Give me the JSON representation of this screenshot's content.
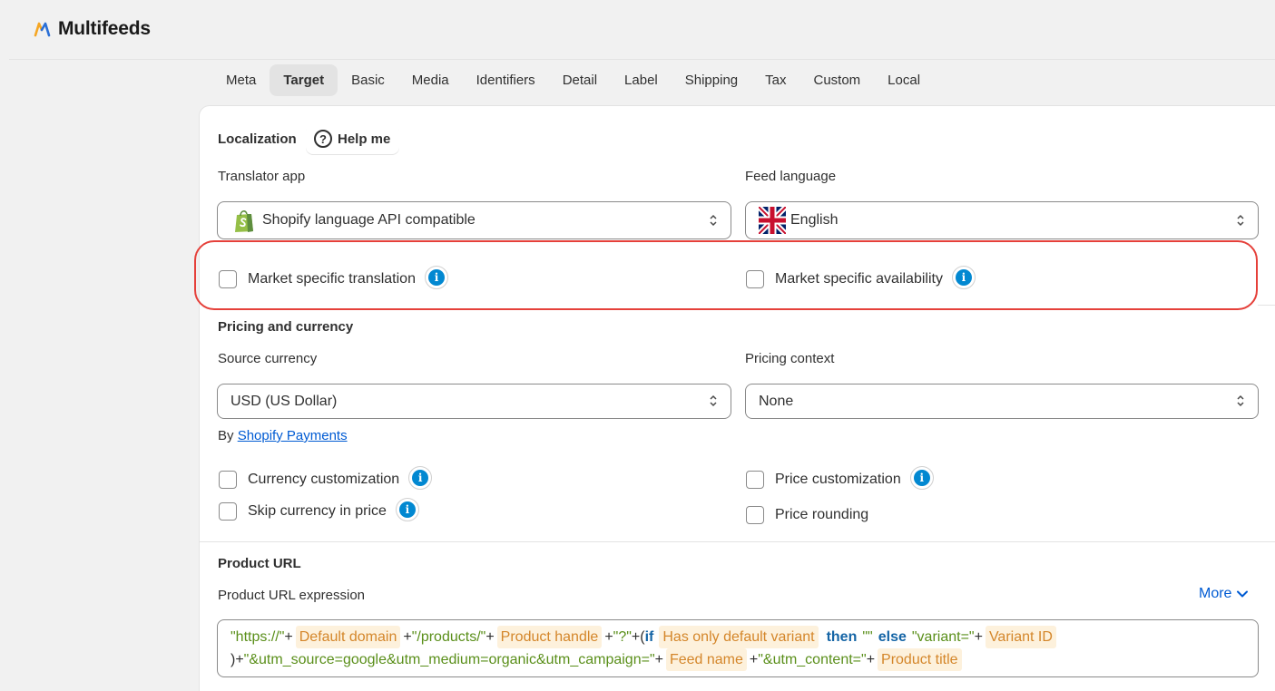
{
  "app": {
    "title": "Multifeeds"
  },
  "tabs": [
    {
      "label": "Meta",
      "active": false
    },
    {
      "label": "Target",
      "active": true
    },
    {
      "label": "Basic",
      "active": false
    },
    {
      "label": "Media",
      "active": false
    },
    {
      "label": "Identifiers",
      "active": false
    },
    {
      "label": "Detail",
      "active": false
    },
    {
      "label": "Label",
      "active": false
    },
    {
      "label": "Shipping",
      "active": false
    },
    {
      "label": "Tax",
      "active": false
    },
    {
      "label": "Custom",
      "active": false
    },
    {
      "label": "Local",
      "active": false
    }
  ],
  "localization": {
    "title": "Localization",
    "help_label": "Help me",
    "translator_label": "Translator app",
    "translator_value": "Shopify language API compatible",
    "feed_language_label": "Feed language",
    "feed_language_value": "English",
    "market_translation_label": "Market specific translation",
    "market_availability_label": "Market specific availability"
  },
  "pricing": {
    "title": "Pricing and currency",
    "source_currency_label": "Source currency",
    "source_currency_value": "USD (US Dollar)",
    "pricing_context_label": "Pricing context",
    "pricing_context_value": "None",
    "by_text": "By",
    "by_link": "Shopify Payments",
    "currency_customization_label": "Currency customization",
    "skip_currency_label": "Skip currency in price",
    "price_customization_label": "Price customization",
    "price_rounding_label": "Price rounding"
  },
  "product_url": {
    "title": "Product URL",
    "expression_label": "Product URL expression",
    "more_label": "More",
    "line1": {
      "s1": "\"https://\"",
      "plus": "+",
      "t1": "Default domain",
      "s2": "\"/products/\"",
      "t2": "Product handle",
      "s3": "\"?\"",
      "paren_if_open": "+(",
      "kw_if": "if",
      "t3": "Has only default variant",
      "kw_then": "then",
      "s4": "\"\"",
      "kw_else": "else",
      "s5": "\"variant=\"",
      "t4": "Variant ID"
    },
    "line2": {
      "close": ")+",
      "s6": "\"&utm_source=google&utm_medium=organic&utm_campaign=\"",
      "t5": "Feed name",
      "s7": "\"&utm_content=\"",
      "t6": "Product title"
    }
  },
  "colors": {
    "accent_link": "#005bd3",
    "highlight_outline": "#e5403a",
    "info_icon": "#0288d1",
    "token_bg": "#fdf1dc",
    "token_text": "#d4862a",
    "string_text": "#5a8f1a",
    "keyword_text": "#1565a6"
  }
}
